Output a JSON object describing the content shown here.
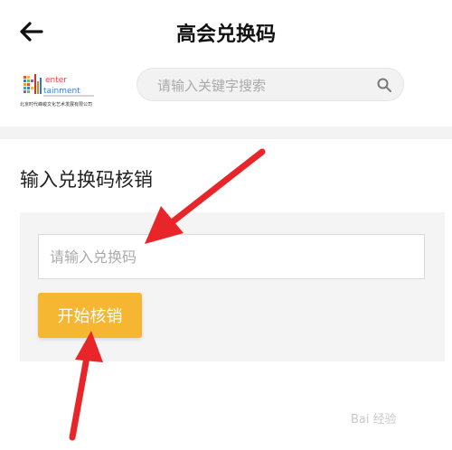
{
  "header": {
    "title": "高会兑换码",
    "back_icon": "arrow-left-icon"
  },
  "brand": {
    "logo_word_top": "enter",
    "logo_word_bottom": "tainment",
    "logo_caption": "北京时代峰峻文化艺术发展有限公司"
  },
  "search": {
    "placeholder": "请输入关键字搜索",
    "icon": "search-icon"
  },
  "redeem": {
    "section_title": "输入兑换码核销",
    "input_placeholder": "请输入兑换码",
    "button_label": "开始核销",
    "button_color": "#f5b731"
  },
  "annotations": {
    "arrow_color": "#e8262a"
  },
  "watermark": {
    "text": "Bai 经验"
  }
}
